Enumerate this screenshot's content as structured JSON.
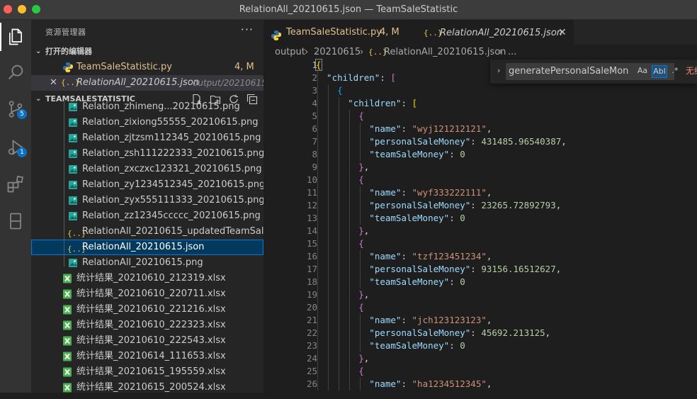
{
  "window": {
    "title": "RelationAll_20210615.json — TeamSaleStatistic"
  },
  "activity_bar": {
    "items": [
      {
        "name": "explorer",
        "badge": null
      },
      {
        "name": "search",
        "badge": null
      },
      {
        "name": "source-control",
        "badge": "5"
      },
      {
        "name": "run-debug",
        "badge": "1"
      },
      {
        "name": "extensions",
        "badge": null
      },
      {
        "name": "remote",
        "badge": null
      }
    ]
  },
  "sidebar": {
    "title": "资源管理器",
    "more": "···",
    "open_editors": {
      "label": "打开的编辑器",
      "items": [
        {
          "icon": "python-icon",
          "name": "TeamSaleStatistic.py",
          "status": "4, M",
          "path": ""
        },
        {
          "icon": "json-icon",
          "name": "RelationAll_20210615.json",
          "status": "",
          "path": "output/20210615"
        }
      ]
    },
    "project": {
      "label": "TEAMSALESTATISTIC",
      "files": [
        {
          "icon": "image-icon",
          "name": "Relation_zhimeng...20210615.png",
          "indent": 2
        },
        {
          "icon": "image-icon",
          "name": "Relation_zixiong55555_20210615.png",
          "indent": 2
        },
        {
          "icon": "image-icon",
          "name": "Relation_zjtzsm112345_20210615.png",
          "indent": 2
        },
        {
          "icon": "image-icon",
          "name": "Relation_zsh111222333_20210615.png",
          "indent": 2
        },
        {
          "icon": "image-icon",
          "name": "Relation_zxczxc123321_20210615.png",
          "indent": 2
        },
        {
          "icon": "image-icon",
          "name": "Relation_zy1234512345_20210615.png",
          "indent": 2
        },
        {
          "icon": "image-icon",
          "name": "Relation_zyx555111333_20210615.png",
          "indent": 2
        },
        {
          "icon": "image-icon",
          "name": "Relation_zz12345ccccc_20210615.png",
          "indent": 2
        },
        {
          "icon": "json-icon",
          "name": "RelationAll_20210615_updatedTeamSal...",
          "indent": 2
        },
        {
          "icon": "json-icon",
          "name": "RelationAll_20210615.json",
          "indent": 2,
          "selected": true
        },
        {
          "icon": "image-icon",
          "name": "RelationAll_20210615.png",
          "indent": 2
        },
        {
          "icon": "excel-icon",
          "name": "统计结果_20210610_212319.xlsx",
          "indent": 1
        },
        {
          "icon": "excel-icon",
          "name": "统计结果_20210610_220711.xlsx",
          "indent": 1
        },
        {
          "icon": "excel-icon",
          "name": "统计结果_20210610_221216.xlsx",
          "indent": 1
        },
        {
          "icon": "excel-icon",
          "name": "统计结果_20210610_222323.xlsx",
          "indent": 1
        },
        {
          "icon": "excel-icon",
          "name": "统计结果_20210610_222543.xlsx",
          "indent": 1
        },
        {
          "icon": "excel-icon",
          "name": "统计结果_20210614_111653.xlsx",
          "indent": 1
        },
        {
          "icon": "excel-icon",
          "name": "统计结果_20210615_195559.xlsx",
          "indent": 1
        },
        {
          "icon": "excel-icon",
          "name": "统计结果_20210615_200524.xlsx",
          "indent": 1
        }
      ]
    }
  },
  "editor": {
    "tabs": [
      {
        "label": "TeamSaleStatistic.py",
        "status": "4, M",
        "active": false
      },
      {
        "label": "RelationAll_20210615.json",
        "status": "",
        "active": true
      }
    ],
    "breadcrumb": [
      "output",
      "20210615",
      "RelationAll_20210615.json",
      "..."
    ],
    "find_widget": {
      "query": "generatePersonalSaleMon",
      "opt_case": "Aa",
      "opt_word": "Abl",
      "opt_regex": ".*",
      "result": "无结果"
    },
    "current_line": 1,
    "lines": [
      {
        "n": 1,
        "indent": 0,
        "tokens": [
          [
            "b1",
            "{"
          ]
        ]
      },
      {
        "n": 2,
        "indent": 1,
        "tokens": [
          [
            "k",
            "\"children\""
          ],
          [
            "p",
            ": "
          ],
          [
            "b2",
            "["
          ]
        ]
      },
      {
        "n": 3,
        "indent": 2,
        "tokens": [
          [
            "b3",
            "{"
          ]
        ]
      },
      {
        "n": 4,
        "indent": 3,
        "tokens": [
          [
            "k",
            "\"children\""
          ],
          [
            "p",
            ": "
          ],
          [
            "b1",
            "["
          ]
        ]
      },
      {
        "n": 5,
        "indent": 4,
        "tokens": [
          [
            "b2",
            "{"
          ]
        ]
      },
      {
        "n": 6,
        "indent": 5,
        "tokens": [
          [
            "k",
            "\"name\""
          ],
          [
            "p",
            ": "
          ],
          [
            "s",
            "\"wyj121212121\""
          ],
          [
            "p",
            ","
          ]
        ]
      },
      {
        "n": 7,
        "indent": 5,
        "tokens": [
          [
            "k",
            "\"personalSaleMoney\""
          ],
          [
            "p",
            ": "
          ],
          [
            "n",
            "431485.96540387"
          ],
          [
            "p",
            ","
          ]
        ]
      },
      {
        "n": 8,
        "indent": 5,
        "tokens": [
          [
            "k",
            "\"teamSaleMoney\""
          ],
          [
            "p",
            ": "
          ],
          [
            "n",
            "0"
          ]
        ]
      },
      {
        "n": 9,
        "indent": 4,
        "tokens": [
          [
            "b2",
            "}"
          ],
          [
            "p",
            ","
          ]
        ]
      },
      {
        "n": 10,
        "indent": 4,
        "tokens": [
          [
            "b2",
            "{"
          ]
        ]
      },
      {
        "n": 11,
        "indent": 5,
        "tokens": [
          [
            "k",
            "\"name\""
          ],
          [
            "p",
            ": "
          ],
          [
            "s",
            "\"wyf333222111\""
          ],
          [
            "p",
            ","
          ]
        ]
      },
      {
        "n": 12,
        "indent": 5,
        "tokens": [
          [
            "k",
            "\"personalSaleMoney\""
          ],
          [
            "p",
            ": "
          ],
          [
            "n",
            "23265.72892793"
          ],
          [
            "p",
            ","
          ]
        ]
      },
      {
        "n": 13,
        "indent": 5,
        "tokens": [
          [
            "k",
            "\"teamSaleMoney\""
          ],
          [
            "p",
            ": "
          ],
          [
            "n",
            "0"
          ]
        ]
      },
      {
        "n": 14,
        "indent": 4,
        "tokens": [
          [
            "b2",
            "}"
          ],
          [
            "p",
            ","
          ]
        ]
      },
      {
        "n": 15,
        "indent": 4,
        "tokens": [
          [
            "b2",
            "{"
          ]
        ]
      },
      {
        "n": 16,
        "indent": 5,
        "tokens": [
          [
            "k",
            "\"name\""
          ],
          [
            "p",
            ": "
          ],
          [
            "s",
            "\"tzf123451234\""
          ],
          [
            "p",
            ","
          ]
        ]
      },
      {
        "n": 17,
        "indent": 5,
        "tokens": [
          [
            "k",
            "\"personalSaleMoney\""
          ],
          [
            "p",
            ": "
          ],
          [
            "n",
            "93156.16512627"
          ],
          [
            "p",
            ","
          ]
        ]
      },
      {
        "n": 18,
        "indent": 5,
        "tokens": [
          [
            "k",
            "\"teamSaleMoney\""
          ],
          [
            "p",
            ": "
          ],
          [
            "n",
            "0"
          ]
        ]
      },
      {
        "n": 19,
        "indent": 4,
        "tokens": [
          [
            "b2",
            "}"
          ],
          [
            "p",
            ","
          ]
        ]
      },
      {
        "n": 20,
        "indent": 4,
        "tokens": [
          [
            "b2",
            "{"
          ]
        ]
      },
      {
        "n": 21,
        "indent": 5,
        "tokens": [
          [
            "k",
            "\"name\""
          ],
          [
            "p",
            ": "
          ],
          [
            "s",
            "\"jch123123123\""
          ],
          [
            "p",
            ","
          ]
        ]
      },
      {
        "n": 22,
        "indent": 5,
        "tokens": [
          [
            "k",
            "\"personalSaleMoney\""
          ],
          [
            "p",
            ": "
          ],
          [
            "n",
            "45692.213125"
          ],
          [
            "p",
            ","
          ]
        ]
      },
      {
        "n": 23,
        "indent": 5,
        "tokens": [
          [
            "k",
            "\"teamSaleMoney\""
          ],
          [
            "p",
            ": "
          ],
          [
            "n",
            "0"
          ]
        ]
      },
      {
        "n": 24,
        "indent": 4,
        "tokens": [
          [
            "b2",
            "}"
          ],
          [
            "p",
            ","
          ]
        ]
      },
      {
        "n": 25,
        "indent": 4,
        "tokens": [
          [
            "b2",
            "{"
          ]
        ]
      },
      {
        "n": 26,
        "indent": 5,
        "tokens": [
          [
            "k",
            "\"name\""
          ],
          [
            "p",
            ": "
          ],
          [
            "s",
            "\"ha1234512345\""
          ],
          [
            "p",
            ","
          ]
        ]
      }
    ]
  },
  "colors": {
    "accent": "#0078d4",
    "badge": "#0e70c0",
    "json_icon": "#e8c34e",
    "image_icon": "#26a69a",
    "excel_icon": "#4caf50",
    "python_blue": "#3572a5",
    "python_yellow": "#ffd43b",
    "modified": "#e2c08d",
    "no_result": "#f48771"
  }
}
